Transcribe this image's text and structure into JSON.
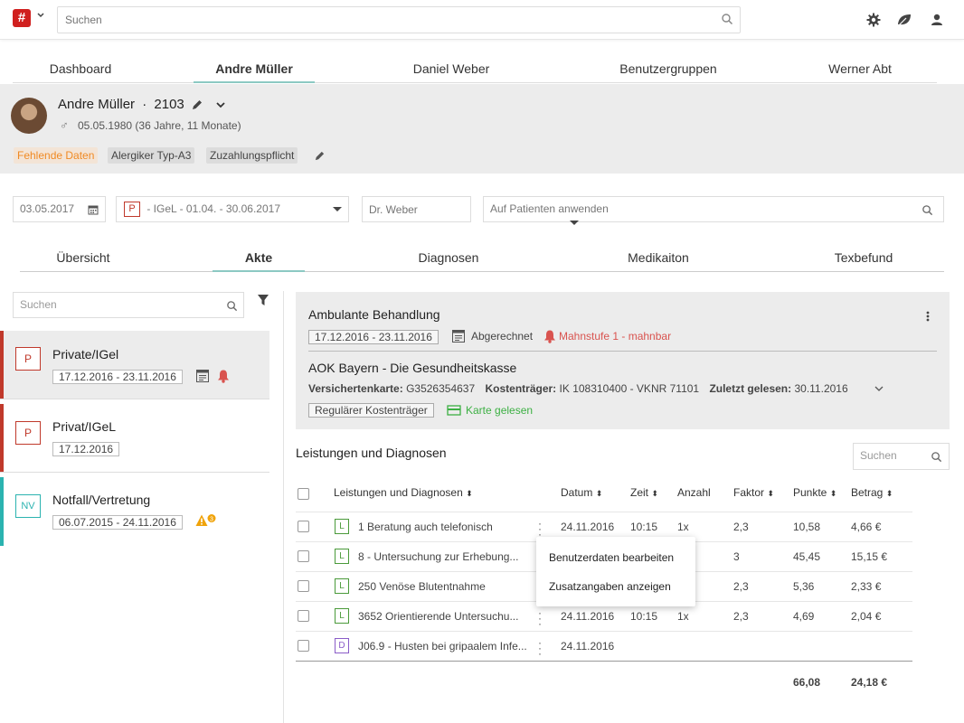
{
  "topbar": {
    "logo_glyph": "#",
    "search_placeholder": "Suchen"
  },
  "main_tabs": [
    {
      "label": "Dashboard",
      "active": false
    },
    {
      "label": "Andre Müller",
      "active": true
    },
    {
      "label": "Daniel Weber",
      "active": false
    },
    {
      "label": "Benutzergruppen",
      "active": false
    },
    {
      "label": "Werner Abt",
      "active": false
    }
  ],
  "patient": {
    "name": "Andre Müller",
    "separator": "·",
    "id": "2103",
    "dob": "05.05.1980 (36 Jahre, 11 Monate)",
    "tags": [
      "Fehlende Daten",
      "Alergiker Typ-A3",
      "Zuzahlungspflicht"
    ]
  },
  "filters": {
    "date": "03.05.2017",
    "case_badge": "P",
    "case_value": "- IGeL - 01.04. - 30.06.2017",
    "doctor_placeholder": "Dr. Weber",
    "apply_placeholder": "Auf Patienten anwenden"
  },
  "sub_tabs": [
    {
      "label": "Übersicht",
      "active": false
    },
    {
      "label": "Akte",
      "active": true
    },
    {
      "label": "Diagnosen",
      "active": false
    },
    {
      "label": "Medikaiton",
      "active": false
    },
    {
      "label": "Texbefund",
      "active": false
    }
  ],
  "left_panel": {
    "search_placeholder": "Suchen",
    "cases": [
      {
        "badge": "P",
        "title": "Private/IGel",
        "date": "17.12.2016 - 23.11.2016",
        "color": "#c0392b",
        "selected": true
      },
      {
        "badge": "P",
        "title": "Privat/IGeL",
        "date": "17.12.2016",
        "color": "#c0392b",
        "selected": false
      },
      {
        "badge": "NV",
        "title": "Notfall/Vertretung",
        "date": "06.07.2015 - 24.11.2016",
        "color": "#2bb3b0",
        "selected": false
      }
    ]
  },
  "treatment": {
    "title": "Ambulante Behandlung",
    "date": "17.12.2016 - 23.11.2016",
    "status": "Abgerechnet",
    "reminder": "Mahnstufe 1 - mahnbar",
    "insurer": "AOK Bayern - Die Gesundheitskasse",
    "card_label": "Versichertenkarte:",
    "card_value": "G3526354637",
    "payer_label": "Kostenträger:",
    "payer_value": "IK 108310400 - VKNR 71101",
    "read_label": "Zuletzt gelesen:",
    "read_value": "30.11.2016",
    "payer_tag": "Regulärer Kostenträger",
    "card_read": "Karte gelesen"
  },
  "services": {
    "title": "Leistungen und Diagnosen",
    "search_placeholder": "Suchen",
    "columns": [
      "Leistungen und Diagnosen",
      "Datum",
      "Zeit",
      "Anzahl",
      "Faktor",
      "Punkte",
      "Betrag"
    ],
    "rows": [
      {
        "type": "L",
        "name": "1 Beratung auch telefonisch",
        "date": "24.11.2016",
        "time": "10:15",
        "count": "1x",
        "factor": "2,3",
        "points": "10,58",
        "amount": "4,66 €"
      },
      {
        "type": "L",
        "name": "8 - Untersuchung zur Erhebung...",
        "date": "",
        "time": "",
        "count": "",
        "factor": "3",
        "points": "45,45",
        "amount": "15,15 €"
      },
      {
        "type": "L",
        "name": "250 Venöse Blutentnahme",
        "date": "",
        "time": "",
        "count": "",
        "factor": "2,3",
        "points": "5,36",
        "amount": "2,33 €"
      },
      {
        "type": "L",
        "name": "3652 Orientierende Untersuchu...",
        "date": "24.11.2016",
        "time": "10:15",
        "count": "1x",
        "factor": "2,3",
        "points": "4,69",
        "amount": "2,04 €"
      },
      {
        "type": "D",
        "name": "J06.9 - Husten bei gripaalem Infe...",
        "date": "24.11.2016",
        "time": "",
        "count": "",
        "factor": "",
        "points": "",
        "amount": ""
      }
    ],
    "total_points": "66,08",
    "total_amount": "24,18 €"
  },
  "context_menu": {
    "items": [
      "Benutzerdaten bearbeiten",
      "Zusatzangaben anzeigen"
    ]
  },
  "colors": {
    "brand": "#d0201f",
    "accent": "#8cc9c3",
    "warn": "#f08a24",
    "alert": "#d9534f",
    "ok": "#3cb043"
  }
}
